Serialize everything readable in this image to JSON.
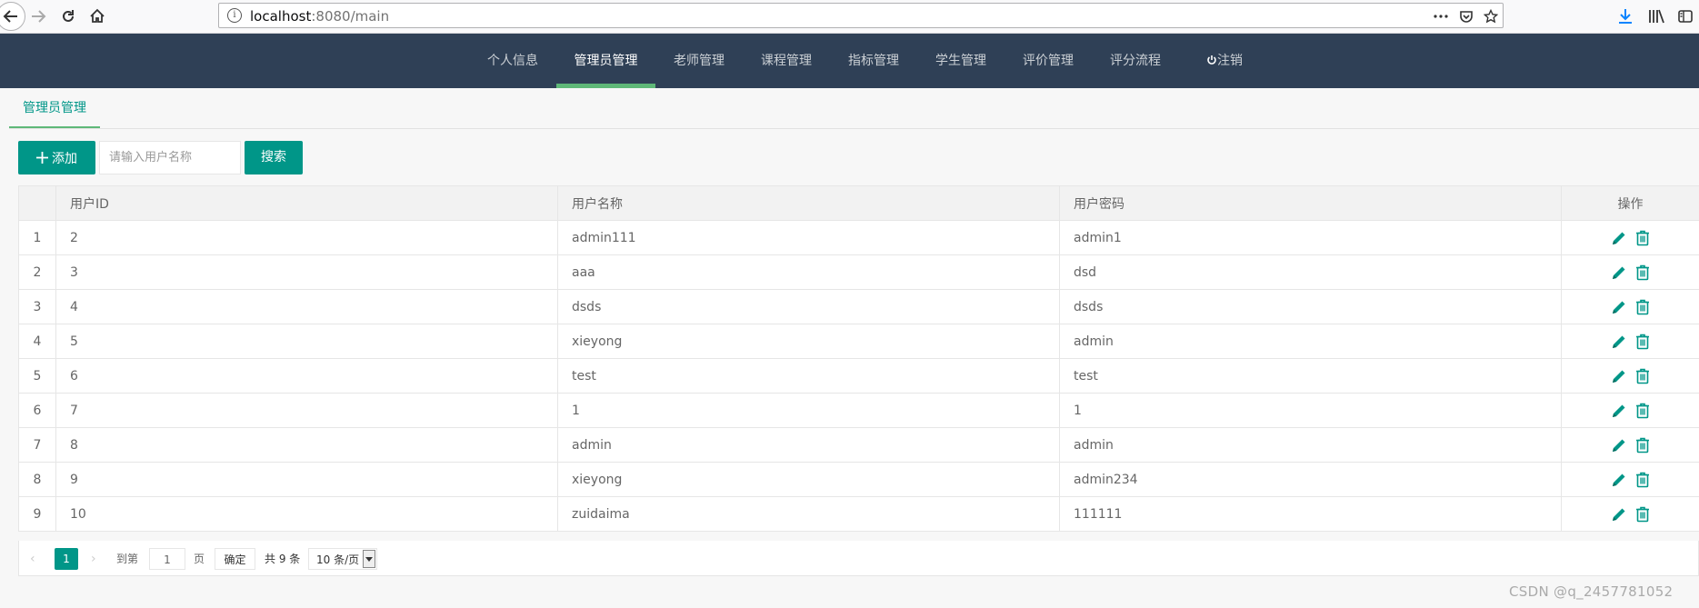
{
  "browser": {
    "url_host": "localhost",
    "url_rest": ":8080/main"
  },
  "nav": {
    "items": [
      "个人信息",
      "管理员管理",
      "老师管理",
      "课程管理",
      "指标管理",
      "学生管理",
      "评价管理",
      "评分流程",
      "注销"
    ],
    "active": "管理员管理"
  },
  "tab": {
    "title": "管理员管理"
  },
  "toolbar": {
    "add_label": "添加",
    "search_placeholder": "请输入用户名称",
    "search_label": "搜索"
  },
  "table": {
    "headers": {
      "id": "用户ID",
      "name": "用户名称",
      "password": "用户密码",
      "ops": "操作"
    },
    "rows": [
      {
        "idx": "1",
        "id": "2",
        "name": "admin111",
        "password": "admin1"
      },
      {
        "idx": "2",
        "id": "3",
        "name": "aaa",
        "password": "dsd"
      },
      {
        "idx": "3",
        "id": "4",
        "name": "dsds",
        "password": "dsds"
      },
      {
        "idx": "4",
        "id": "5",
        "name": "xieyong",
        "password": "admin"
      },
      {
        "idx": "5",
        "id": "6",
        "name": "test",
        "password": "test"
      },
      {
        "idx": "6",
        "id": "7",
        "name": "1",
        "password": "1"
      },
      {
        "idx": "7",
        "id": "8",
        "name": "admin",
        "password": "admin"
      },
      {
        "idx": "8",
        "id": "9",
        "name": "xieyong",
        "password": "admin234"
      },
      {
        "idx": "9",
        "id": "10",
        "name": "zuidaima",
        "password": "111111"
      }
    ]
  },
  "pager": {
    "current_page": "1",
    "goto_label": "到第",
    "goto_value": "1",
    "page_unit": "页",
    "confirm_label": "确定",
    "total_label": "共 9 条",
    "limit_label": "10 条/页"
  },
  "watermark": "CSDN @q_2457781052",
  "colors": {
    "nav_bg": "#2f4056",
    "accent": "#009688",
    "nav_active_bar": "#5fb878"
  }
}
